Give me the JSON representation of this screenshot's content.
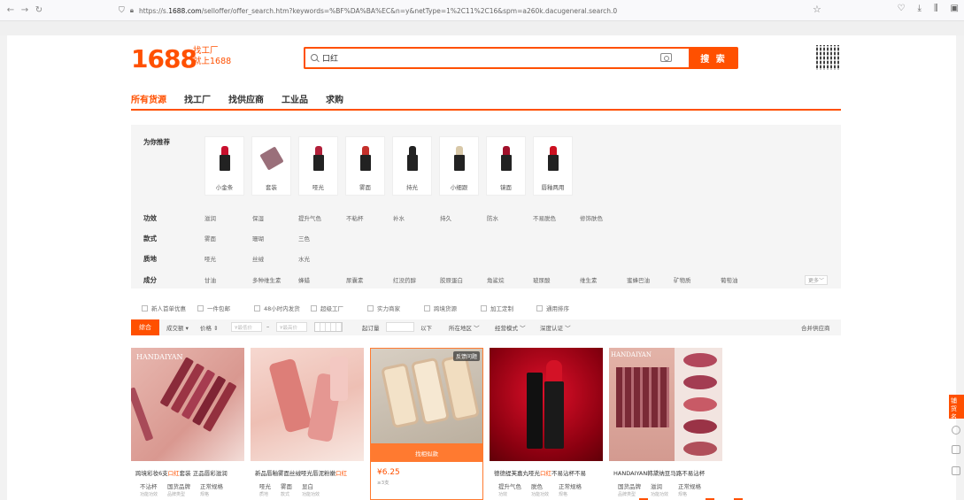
{
  "browser": {
    "url_prefix": "https://s.",
    "url_domain": "1688.com",
    "url_rest": "/selloffer/offer_search.htm?keywords=%BF%DA%BA%EC&n=y&netType=1%2C11%2C16&spm=a260k.dacugeneral.search.0"
  },
  "header": {
    "logo_text": "1688",
    "logo_tag_1": "找工厂",
    "logo_tag_2": "就上1688",
    "search_value": "口红",
    "search_button": "搜 索"
  },
  "category_nav": [
    "所有货源",
    "找工厂",
    "找供应商",
    "工业品",
    "求购"
  ],
  "recommend": {
    "label": "为你推荐",
    "items": [
      {
        "label": "小金条",
        "color": "#c8102e"
      },
      {
        "label": "套装",
        "color": "#9a6f7a"
      },
      {
        "label": "哑光",
        "color": "#b2203a"
      },
      {
        "label": "雾面",
        "color": "#c4302b"
      },
      {
        "label": "持光",
        "color": "#222222"
      },
      {
        "label": "小细跟",
        "color": "#d8c8a8"
      },
      {
        "label": "镜面",
        "color": "#a0102a"
      },
      {
        "label": "唇釉两用",
        "color": "#cc1020"
      }
    ]
  },
  "attributes": [
    {
      "key": "功效",
      "values": [
        "滋润",
        "保湿",
        "提升气色",
        "不粘杯",
        "补水",
        "持久",
        "防水",
        "不易脱色",
        "修饰肤色"
      ]
    },
    {
      "key": "款式",
      "values": [
        "雾面",
        "珊瑚",
        "三色"
      ]
    },
    {
      "key": "质地",
      "values": [
        "哑光",
        "丝绒",
        "水光"
      ]
    },
    {
      "key": "成分",
      "values": [
        "甘油",
        "多种维生素",
        "蜂蜡",
        "尿囊素",
        "红没药醇",
        "胶原蛋白",
        "角鲨烷",
        "玻尿酸",
        "维生素",
        "蜜蜂巴油",
        "矿物质",
        "葡萄油"
      ]
    }
  ],
  "more_button": "更多",
  "checkbox_filters": [
    "新人首单优惠",
    "一件包邮",
    "48小时内发货",
    "超级工厂",
    "实力商家",
    "跨境货源",
    "加工定制",
    "通用排序"
  ],
  "sort": {
    "active": "综合",
    "items": [
      "成交额",
      "价格"
    ],
    "price_min_placeholder": "¥最低价",
    "price_max_placeholder": "¥最高价",
    "qty_label": "起订量",
    "qty_unit": "以下",
    "location": "所在地区",
    "mode": "经营模式",
    "cert": "深度认证",
    "compare": "合并供应商"
  },
  "products": [
    {
      "title_pre": "跨境彩妆6支",
      "title_hl": "口红",
      "title_post": "套装 正品唇彩滋润",
      "tags": [
        [
          "不沾杯",
          "功能功效"
        ],
        [
          "国货品牌",
          "品牌类型"
        ],
        [
          "正常规格",
          "规格"
        ]
      ]
    },
    {
      "title_pre": "新品唇釉雾面丝绒哑光唇泥粉嫩",
      "title_hl": "口红",
      "title_post": "",
      "tags": [
        [
          "哑光",
          "质地"
        ],
        [
          "雾面",
          "款式"
        ],
        [
          "显白",
          "功能功效"
        ]
      ]
    },
    {
      "price": "¥6.25",
      "sold": "≥3支",
      "bar": "找相似款",
      "feedback": "反馈问题"
    },
    {
      "title_pre": "德德缇芙嘉丸哑光",
      "title_hl": "口红",
      "title_post": "不易沾杯不易",
      "tags": [
        [
          "提升气色",
          "功效"
        ],
        [
          "脱色",
          "功能功效"
        ],
        [
          "正常规格",
          "规格"
        ]
      ]
    },
    {
      "title_pre": "HANDAIYAN韩黛纳豆马路不易沾杯",
      "title_hl": "",
      "title_post": "",
      "tags": [
        [
          "国货品牌",
          "品牌类型"
        ],
        [
          "滋润",
          "功能功效"
        ],
        [
          "正常规格",
          "规格"
        ]
      ]
    }
  ],
  "side_widget": "铺货",
  "side_widget_2": "名片"
}
